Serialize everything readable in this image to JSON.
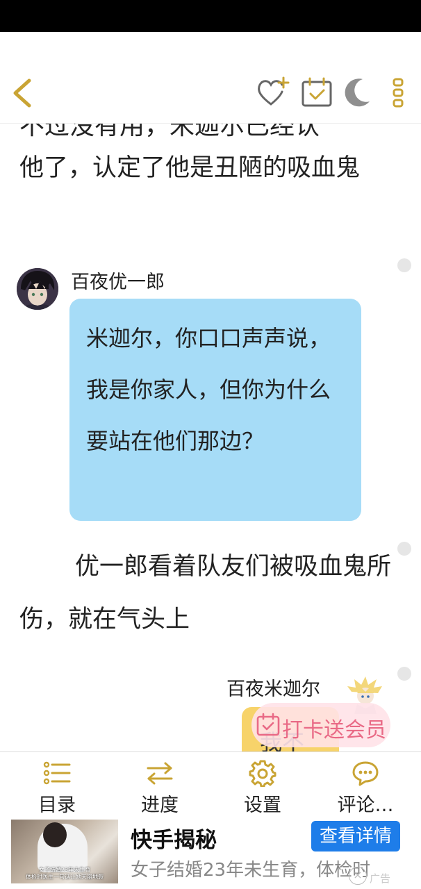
{
  "reader": {
    "cut_line_top": "不过没有用，米迦尔已经认",
    "paragraph_1": "他了，认定了他是丑陋的吸血鬼",
    "chat_left": {
      "name": "百夜优一郎",
      "message": "米迦尔，你口口声声说，我是你家人，但你为什么要站在他们那边？"
    },
    "paragraph_2": "优一郎看着队友们被吸血鬼所伤，就在气头上",
    "chat_right": {
      "name": "百夜米迦尔",
      "message_partial": "我不"
    }
  },
  "promo": {
    "label": "打卡送会员"
  },
  "bottom_nav": {
    "items": [
      {
        "label": "目录",
        "icon": "list-icon"
      },
      {
        "label": "进度",
        "icon": "swap-arrows-icon"
      },
      {
        "label": "设置",
        "icon": "gear-icon"
      },
      {
        "label": "评论…",
        "icon": "comment-icon"
      }
    ]
  },
  "ad": {
    "title": "快手揭秘",
    "button": "查看详情",
    "description": "女子结婚23年未生育，体检时",
    "thumb_caption_1": "女子结婚23年未生育",
    "thumb_caption_2": "体检时医生一句话让她天崩地裂",
    "tag": "广告",
    "close": "×"
  },
  "colors": {
    "accent_icon": "#c9a434",
    "left_bubble": "#a6dcf7",
    "right_bubble": "#f7d36a",
    "promo_text": "#e96a86",
    "ad_button": "#1e7de9"
  }
}
